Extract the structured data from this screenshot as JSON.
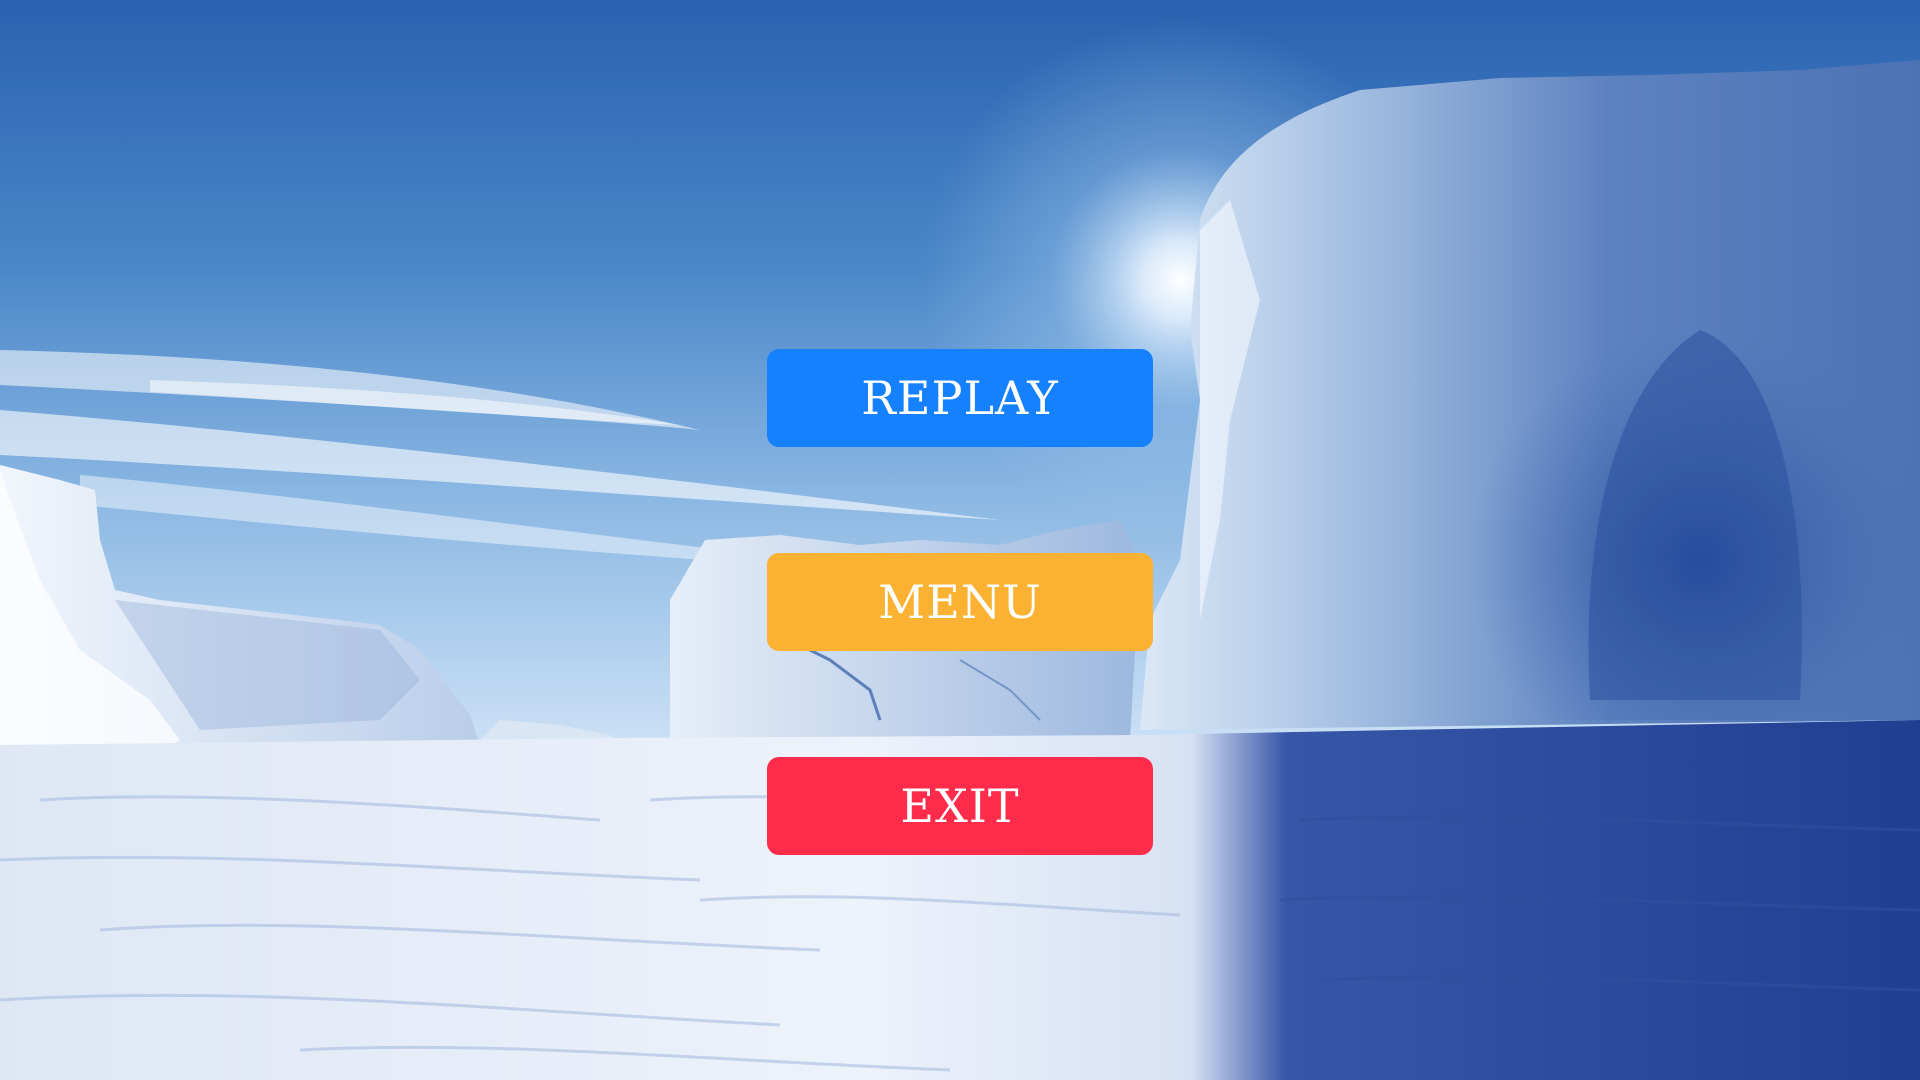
{
  "buttons": {
    "replay": {
      "label": "REPLAY",
      "color": "#1581ff"
    },
    "menu": {
      "label": "MENU",
      "color": "#fbb131"
    },
    "exit": {
      "label": "EXIT",
      "color": "#fe2b4b"
    }
  },
  "background": {
    "scene": "antarctic ice landscape with iceberg arch",
    "sky_color": "#3f7fc4",
    "snow_color": "#e8eef8",
    "shadow_color": "#25479a"
  }
}
